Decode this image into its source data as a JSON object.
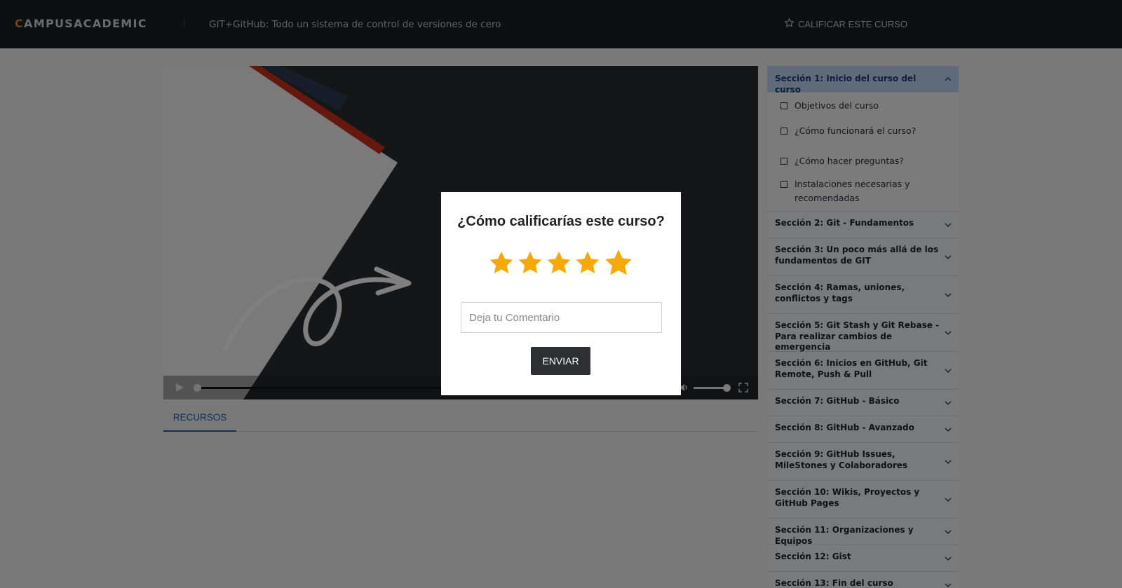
{
  "header": {
    "logo_first": "C",
    "logo_rest": "AMPUSACADEMIC",
    "course_title": "GIT+GitHub: Todo un sistema de control de versiones de cero",
    "rate_label": "CALIFICAR ESTE CURSO"
  },
  "tabs": {
    "resources_label": "RECURSOS"
  },
  "sidebar": {
    "active_section": "Sección 1: Inicio del curso del curso",
    "lessons": [
      "Objetivos del curso",
      "¿Cómo funcionará el curso?",
      "¿Cómo hacer preguntas?",
      "Instalaciones necesarias y recomendadas"
    ],
    "sections": [
      "Sección 2: Git - Fundamentos",
      "Sección 3: Un poco más allá de los fundamentos de GIT",
      "Sección 4: Ramas, uniones, conflictos y tags",
      "Sección 5: Git Stash y Git Rebase - Para realizar cambios de emergencia",
      "Sección 6: Inicios en GitHub, Git Remote, Push & Pull",
      "Sección 7: GitHub - Básico",
      "Sección 8: GitHub - Avanzado",
      "Sección 9: GitHub Issues, MileStones y Colaboradores",
      "Sección 10: Wikis, Proyectos y GitHub Pages",
      "Sección 11: Organizaciones y Equipos",
      "Sección 12: Gist",
      "Sección 13: Fin del curso"
    ]
  },
  "modal": {
    "title": "¿Cómo calificarías este curso?",
    "rating_max": 5,
    "star_color": "#f5a80a",
    "comment_placeholder": "Deja tu Comentario",
    "submit_label": "ENVIAR"
  },
  "colors": {
    "topbar": "#1d1f22",
    "accent": "#e98a2c",
    "link": "#1f5fa8",
    "active_section_bg": "#bfd4f5"
  }
}
